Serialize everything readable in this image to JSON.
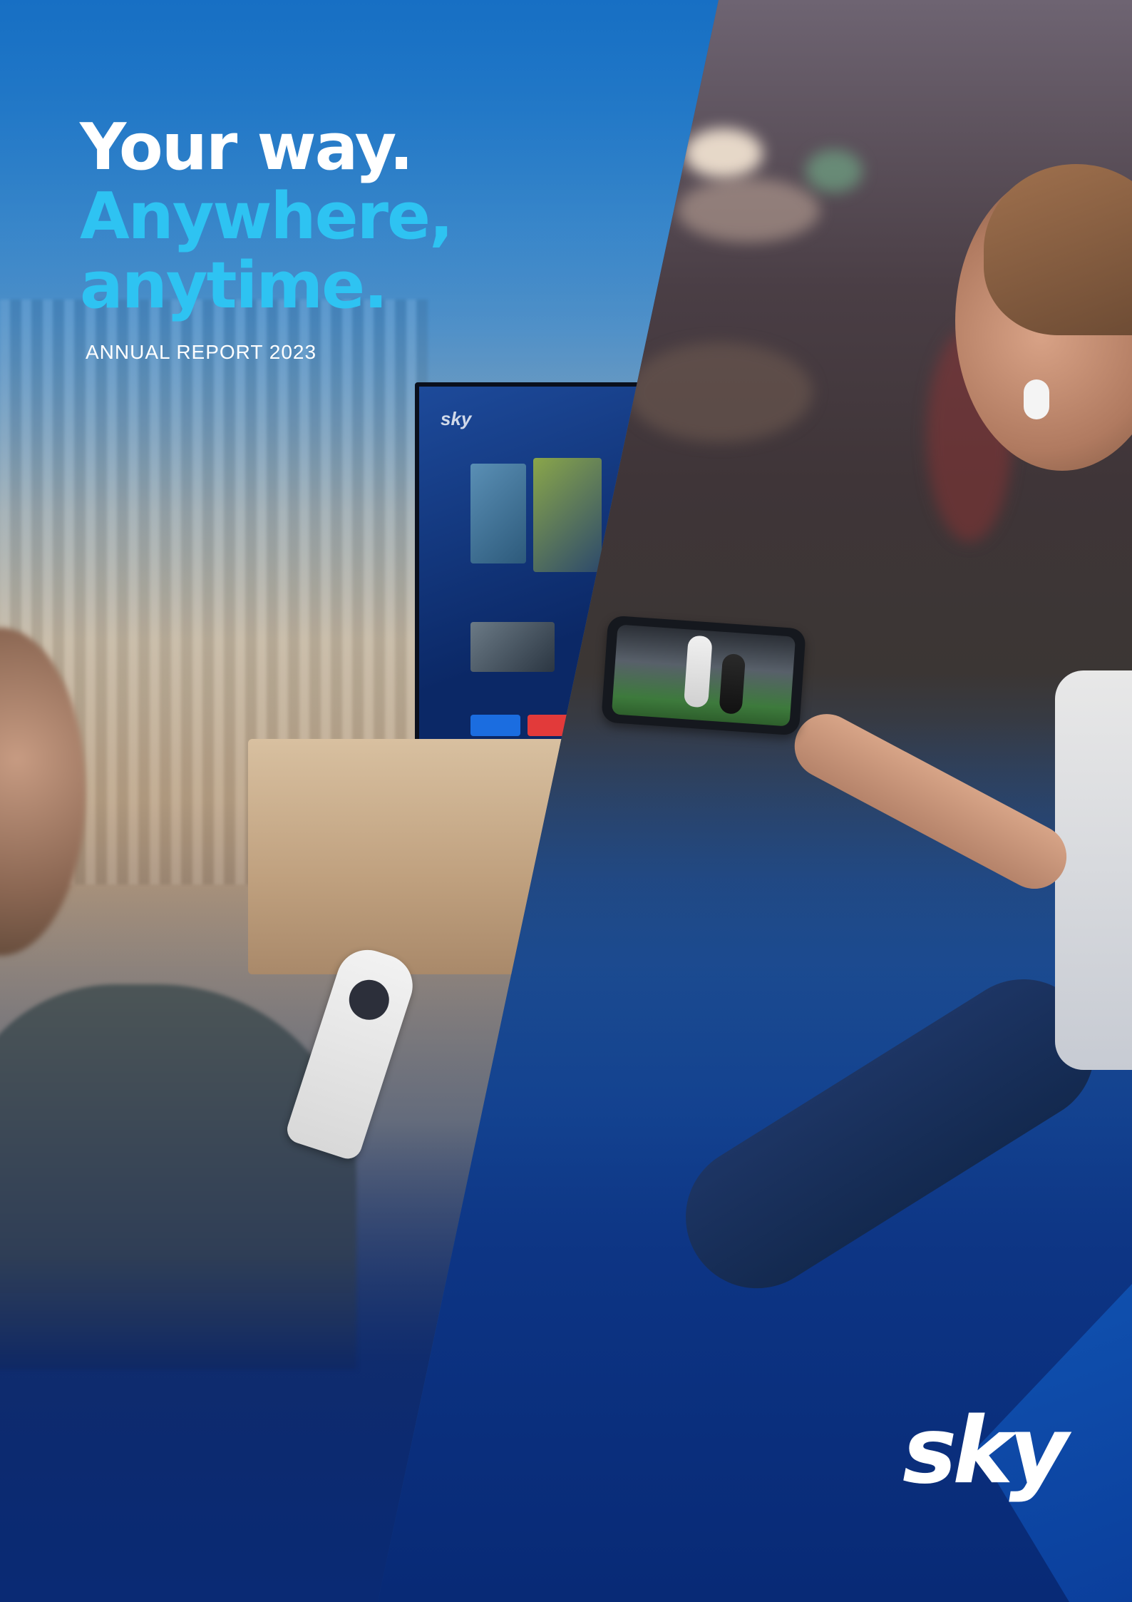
{
  "cover": {
    "headline_line1": "Your way.",
    "headline_line2": "Anywhere,",
    "headline_line3": "anytime.",
    "subtitle": "ANNUAL REPORT 2023",
    "brand_logo_text": "sky"
  },
  "colors": {
    "headline_white": "#ffffff",
    "headline_accent": "#2ec3f2",
    "brand_blue": "#1668c8",
    "background_navy": "#0a2a74"
  }
}
